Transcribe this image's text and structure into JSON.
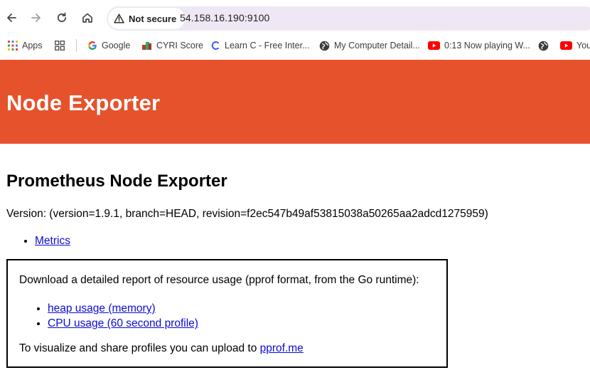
{
  "browser": {
    "security_label": "Not secure",
    "url": "54.158.16.190:9100",
    "bookmarks": [
      {
        "label": "Apps",
        "icon": "apps-grid-icon"
      },
      {
        "label": "",
        "icon": "tab-groups-icon"
      },
      {
        "label": "Google",
        "icon": "google-icon"
      },
      {
        "label": "CYRI Score",
        "icon": "cyri-icon"
      },
      {
        "label": "Learn C - Free Inter...",
        "icon": "learn-c-icon"
      },
      {
        "label": "My Computer Detail...",
        "icon": "globe-icon"
      },
      {
        "label": "0:13 Now playing W...",
        "icon": "youtube-icon"
      },
      {
        "label": "",
        "icon": "globe-icon"
      },
      {
        "label": "You",
        "icon": "youtube-icon"
      }
    ]
  },
  "header": {
    "title": "Node Exporter",
    "color": "#e6522c"
  },
  "main": {
    "heading": "Prometheus Node Exporter",
    "version": "Version: (version=1.9.1, branch=HEAD, revision=f2ec547b49af53815038a50265aa2adcd1275959)",
    "links": [
      {
        "label": "Metrics"
      }
    ],
    "pprof": {
      "intro": "Download a detailed report of resource usage (pprof format, from the Go runtime):",
      "links": [
        {
          "label": "heap usage (memory)"
        },
        {
          "label": "CPU usage (60 second profile)"
        }
      ],
      "footer_text": "To visualize and share profiles you can upload to ",
      "footer_link": "pprof.me"
    }
  }
}
